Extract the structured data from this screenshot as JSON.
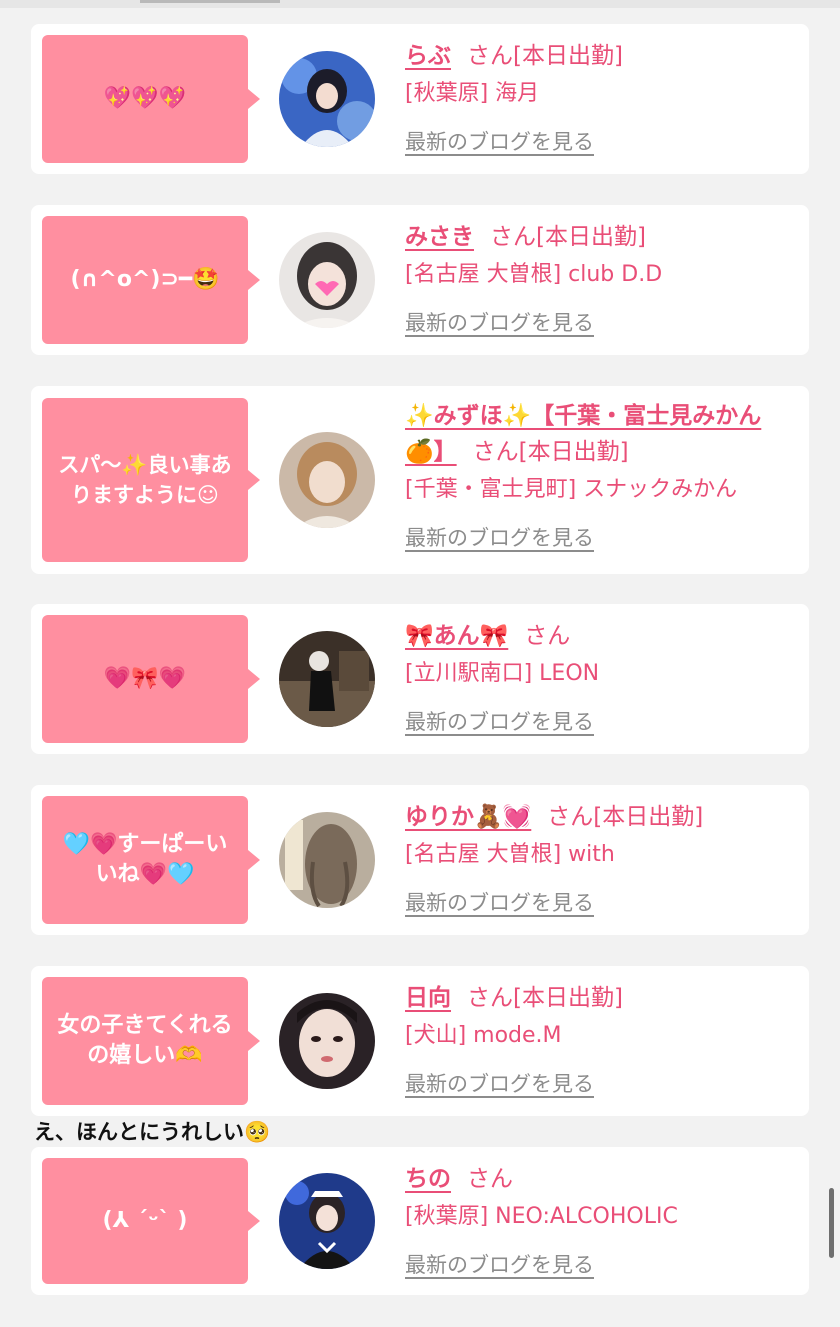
{
  "entries": [
    {
      "bubble": "💖💖💖",
      "name": "らぶ",
      "san": "さん",
      "status": "[本日出勤]",
      "shop": "[秋葉原] 海月",
      "blog": "最新のブログを見る",
      "avatar": "girl-dark-hair-blue-bg"
    },
    {
      "bubble": "(∩^o^)⊃━🤩",
      "name": "みさき",
      "san": "さん",
      "status": "[本日出勤]",
      "shop": "[名古屋 大曽根] club D.D",
      "blog": "最新のブログを見る",
      "avatar": "girl-heart-sticker"
    },
    {
      "bubble": "スパ〜✨良い事あ\nりますように☺",
      "name": "✨みずほ✨【千葉・富士見みかん🍊】",
      "san": "さん",
      "status": "[本日出勤]",
      "shop": "[千葉・富士見町] スナックみかん",
      "blog": "最新のブログを見る",
      "avatar": "girl-light-brown-hair"
    },
    {
      "bubble": "💗🎀💗",
      "name": "🎀あん🎀",
      "san": "さん",
      "status": "",
      "shop": "[立川駅南口] LEON",
      "blog": "最新のブログを見る",
      "avatar": "girl-night-street"
    },
    {
      "bubble": "🩵💗すーぱーい\nいね💗🩵",
      "name": "ゆりか🧸💓",
      "san": "さん",
      "status": "[本日出勤]",
      "shop": "[名古屋 大曽根] with",
      "blog": "最新のブログを見る",
      "avatar": "girl-wavy-hair-back"
    },
    {
      "bubble": "女の子きてくれる\nの嬉しい🫶",
      "name": "日向",
      "san": "さん",
      "status": "[本日出勤]",
      "shop": "[犬山] mode.M",
      "blog": "最新のブログを見る",
      "avatar": "girl-closeup-face"
    },
    {
      "bubble": "(⅄ ˊᵕˋ )",
      "name": "ちの",
      "san": "さん",
      "status": "",
      "shop": "[秋葉原] NEO:ALCOHOLIC",
      "blog": "最新のブログを見る",
      "avatar": "girl-maid-outfit"
    }
  ],
  "comment": "え、ほんとにうれしい🥺",
  "colors": {
    "accent": "#e94e77",
    "bubble": "#ff8fa0",
    "link_gray": "#8c8c8c"
  }
}
